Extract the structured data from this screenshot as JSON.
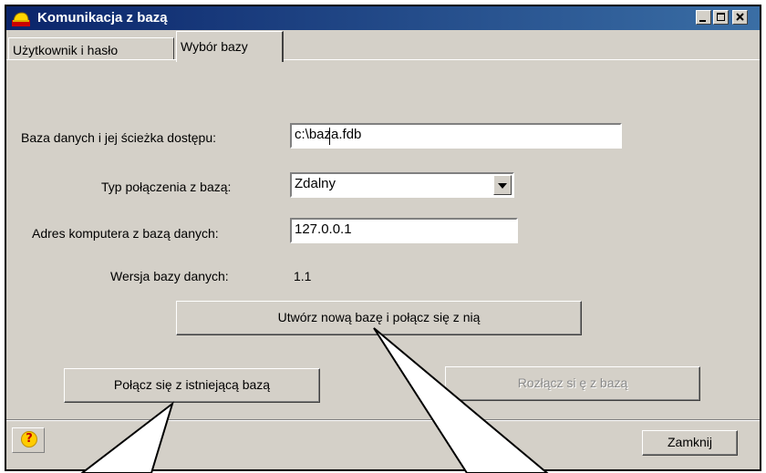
{
  "window": {
    "title": "Komunikacja z bazą",
    "controls": {
      "minimize": "minimize",
      "maximize": "maximize",
      "close": "close"
    }
  },
  "tabs": [
    {
      "label": "Użytkownik i hasło",
      "active": false
    },
    {
      "label": "Wybór bazy",
      "active": true
    }
  ],
  "form": {
    "db_path": {
      "label": "Baza danych i jej ścieżka dostępu:",
      "value": "c:\\baza.fdb"
    },
    "conn_type": {
      "label": "Typ połączenia z bazą:",
      "value": "Zdalny"
    },
    "host": {
      "label": "Adres komputera z bazą danych:",
      "value": "127.0.0.1"
    },
    "version": {
      "label": "Wersja bazy danych:",
      "value": "1.1"
    }
  },
  "buttons": {
    "create_db": "Utwórz nową bazę i połącz się z nią",
    "connect_existing": "Połącz się z istniejącą bazą",
    "disconnect": "Rozłącz si ę z bazą",
    "close": "Zamknij",
    "help": "?"
  },
  "icons": {
    "app": "helmet-icon",
    "help": "help-icon",
    "dropdown": "chevron-down-icon"
  },
  "colors": {
    "titlebar_start": "#0a246a",
    "titlebar_end": "#3a6ea5",
    "face": "#d4d0c8",
    "help_icon": "#ffcc00"
  }
}
